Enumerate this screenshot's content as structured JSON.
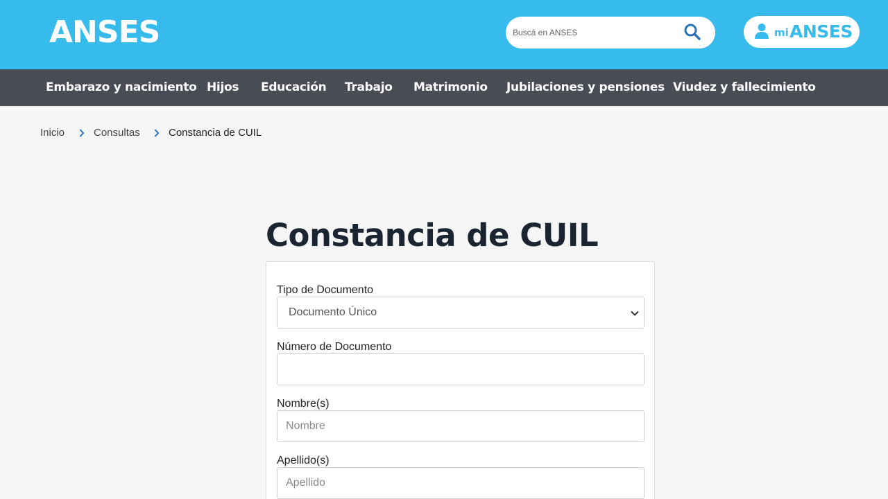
{
  "header": {
    "logo": "ANSES",
    "search": {
      "placeholder": "Buscá en ANSES",
      "value": ""
    },
    "mi_anses": {
      "prefix": "mi",
      "brand": "ANSES"
    }
  },
  "nav": {
    "items": [
      {
        "label": "Embarazo y nacimiento"
      },
      {
        "label": "Hijos"
      },
      {
        "label": "Educación"
      },
      {
        "label": "Trabajo"
      },
      {
        "label": "Matrimonio"
      },
      {
        "label": "Jubilaciones y pensiones"
      },
      {
        "label": "Viudez y fallecimiento"
      }
    ]
  },
  "breadcrumb": {
    "items": [
      {
        "label": "Inicio"
      },
      {
        "label": "Consultas"
      },
      {
        "label": "Constancia de CUIL"
      }
    ]
  },
  "form": {
    "title": "Constancia de CUIL",
    "tipo": {
      "label": "Tipo de Documento",
      "selected": "Documento Único"
    },
    "numero": {
      "label": "Número de Documento",
      "value": "",
      "placeholder": ""
    },
    "nombre": {
      "label": "Nombre(s)",
      "value": "",
      "placeholder": "Nombre"
    },
    "apellido": {
      "label": "Apellido(s)",
      "value": "",
      "placeholder": "Apellido"
    }
  },
  "colors": {
    "header_bg": "#37bbed",
    "nav_bg": "#4a4c55",
    "page_bg": "#f5f5f5",
    "title": "#1b2431"
  },
  "icons": [
    "search-icon",
    "user-icon",
    "chevron-right-icon",
    "chevron-down-icon"
  ]
}
